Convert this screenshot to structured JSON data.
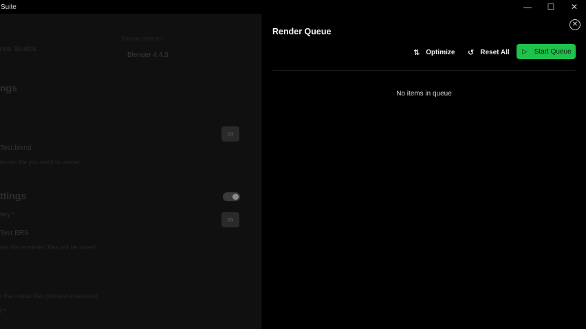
{
  "window": {
    "title": "Suite",
    "controls": {
      "minimize": "—",
      "maximize": "☐",
      "close": "✕"
    }
  },
  "background": {
    "renderer_label": "Blender Selector",
    "studios": "non Studios",
    "version": "Blender 4.4.3",
    "settings_heading": "ngs",
    "file_value": "Test.blend",
    "file_hint": "lender file you want to render",
    "output_heading": "ttings",
    "directory_label": "tory *",
    "directory_value": "Test BRS",
    "directory_hint": "ere the rendered files will be saved",
    "name_hint": "r the output files (without extension)",
    "format_label": "t *"
  },
  "panel": {
    "title": "Render Queue",
    "close_icon": "✕",
    "toolbar": {
      "optimize_label": "Optimize",
      "optimize_icon": "⇅",
      "reset_label": "Reset All",
      "reset_icon": "↺",
      "start_label": "Start Queue",
      "start_icon": "▷"
    },
    "empty_message": "No items in queue"
  },
  "colors": {
    "accent": "#1fc24a",
    "background": "#000000",
    "panel_background": "#000000"
  }
}
